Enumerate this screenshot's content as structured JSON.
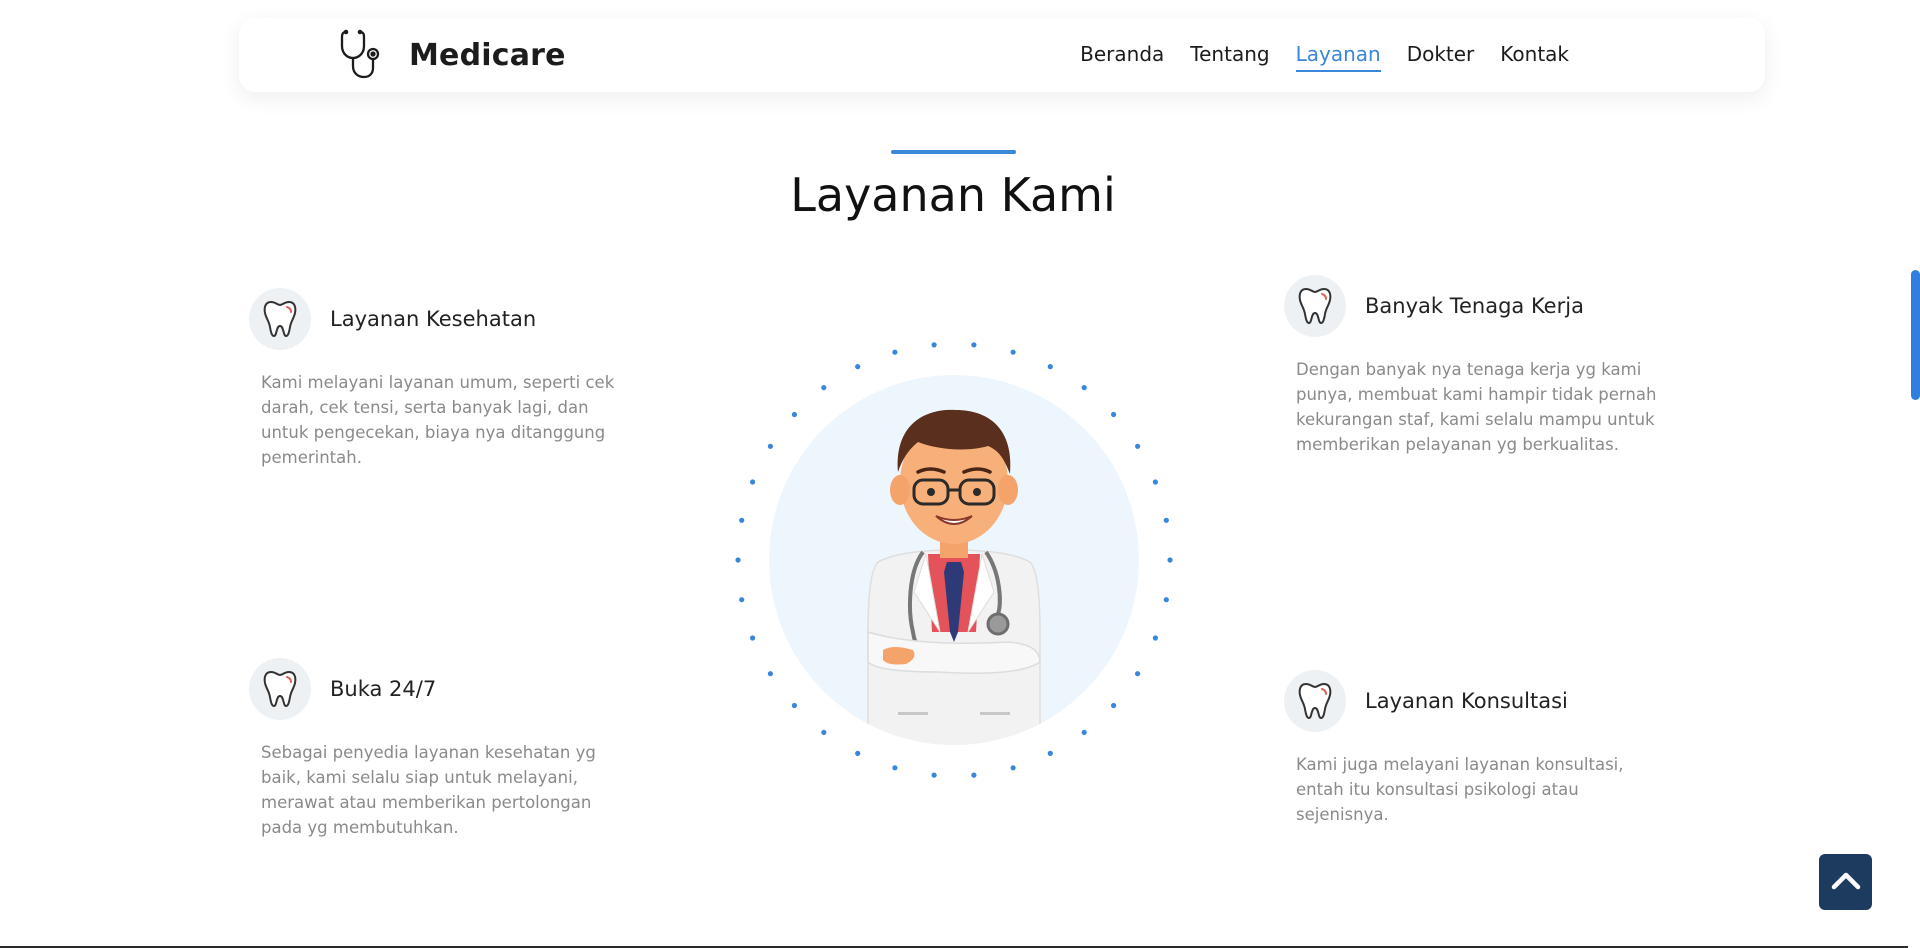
{
  "brand": {
    "name": "Medicare",
    "icon": "stethoscope-icon"
  },
  "nav": {
    "items": [
      {
        "label": "Beranda",
        "active": false
      },
      {
        "label": "Tentang",
        "active": false
      },
      {
        "label": "Layanan",
        "active": true
      },
      {
        "label": "Dokter",
        "active": false
      },
      {
        "label": "Kontak",
        "active": false
      }
    ]
  },
  "section": {
    "title": "Layanan Kami"
  },
  "features": [
    {
      "icon": "tooth-icon",
      "title": "Layanan Kesehatan",
      "description": "Kami melayani layanan umum, seperti cek darah, cek tensi, serta banyak lagi, dan untuk pengecekan, biaya nya ditanggung pemerintah."
    },
    {
      "icon": "tooth-icon",
      "title": "Banyak Tenaga Kerja",
      "description": "Dengan banyak nya tenaga kerja yg kami punya, membuat kami hampir tidak pernah kekurangan staf, kami selalu mampu untuk memberikan pelayanan yg berkualitas."
    },
    {
      "icon": "tooth-icon",
      "title": "Buka 24/7",
      "description": "Sebagai penyedia layanan kesehatan yg baik, kami selalu siap untuk melayani, merawat atau memberikan pertolongan pada yg membutuhkan."
    },
    {
      "icon": "tooth-icon",
      "title": "Layanan Konsultasi",
      "description": "Kami juga melayani layanan konsultasi, entah itu konsultasi psikologi atau sejenisnya."
    }
  ],
  "colors": {
    "accent": "#3a86d8",
    "back_to_top": "#1d3a5f",
    "muted_text": "#8a8a8a"
  },
  "back_to_top": {
    "icon": "chevron-up-icon"
  }
}
